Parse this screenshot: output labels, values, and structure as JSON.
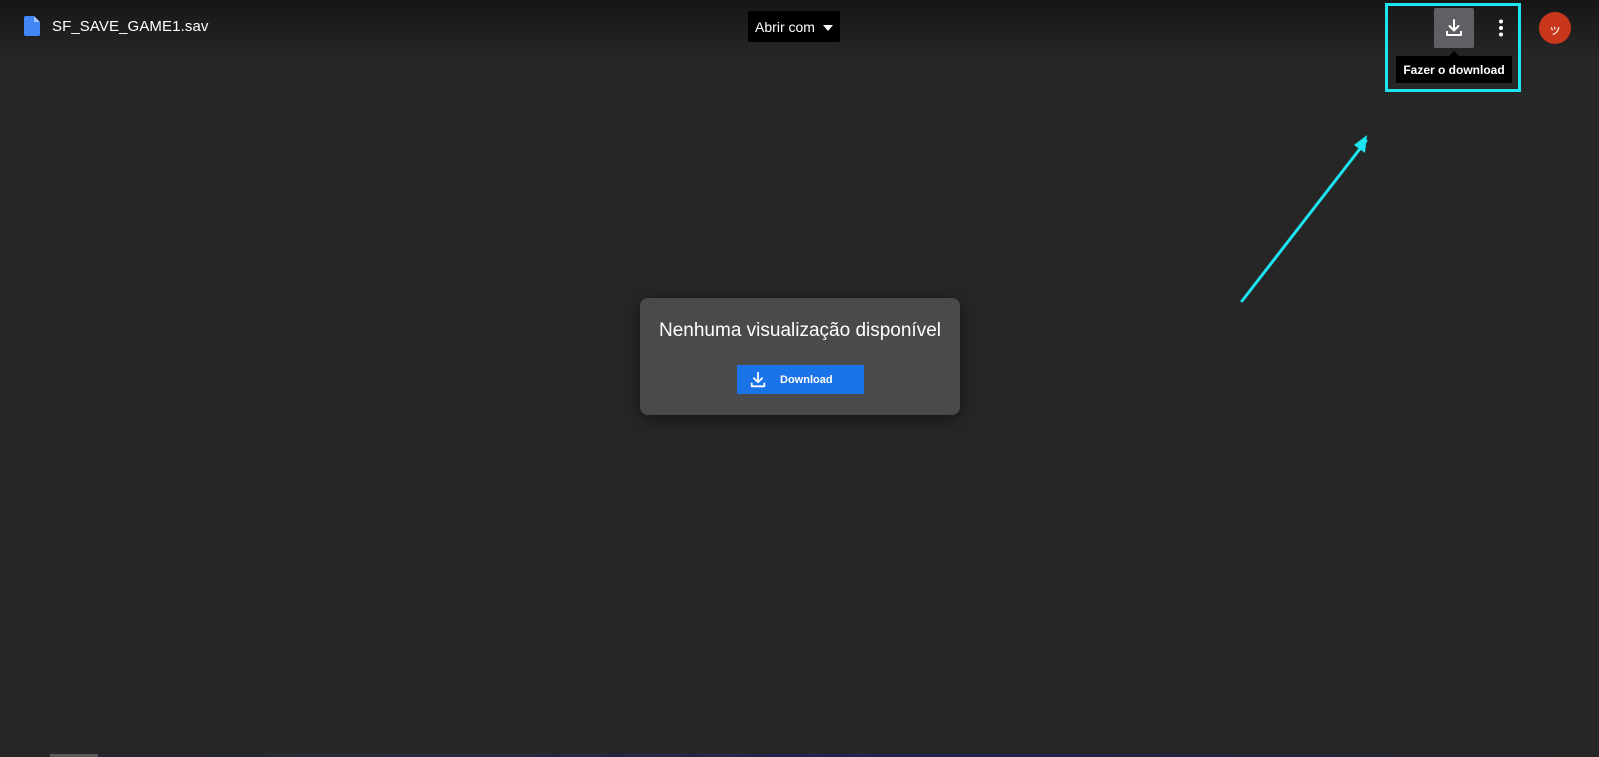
{
  "header": {
    "file_name": "SF_SAVE_GAME1.sav",
    "file_icon": "document-icon",
    "open_with_label": "Abrir com",
    "download_icon": "download-icon",
    "more_icon": "more-vert-icon",
    "avatar_text": "ッ",
    "tooltip_text": "Fazer o download"
  },
  "preview": {
    "message": "Nenhuma visualização disponível",
    "download_label": "Download"
  },
  "colors": {
    "background": "#262626",
    "file_icon": "#4285f4",
    "download_button": "#1a73e8",
    "avatar": "#c8361b",
    "highlight": "#1ee3f0"
  }
}
